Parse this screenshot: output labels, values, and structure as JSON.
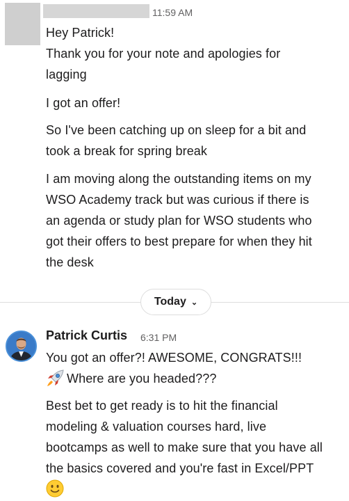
{
  "first_message": {
    "timestamp": "11:59 AM",
    "lines": [
      "Hey Patrick!",
      "Thank you for your note and apologies for",
      "lagging",
      "I got an offer!",
      "So I've been catching up on sleep for a bit and",
      "took a break for spring break",
      "I am moving along the outstanding items on my",
      "WSO Academy track but was curious if there is",
      "an agenda or study plan for WSO students who",
      "got their offers to best prepare for when they hit",
      "the desk"
    ]
  },
  "date_divider": {
    "label": "Today",
    "icon": "chevron-down-icon"
  },
  "second_message": {
    "sender": "Patrick Curtis",
    "timestamp": "6:31 PM",
    "lines": [
      "You got an offer?!  AWESOME, CONGRATS!!!",
      "Where are you headed???",
      "Best bet to get ready is to hit the financial",
      "modeling & valuation courses hard, live",
      "bootcamps as well to make sure that you have all",
      "the basics covered and you're fast in Excel/PPT"
    ],
    "emojis": [
      "rocket-icon",
      "slightly-smiling-face-icon"
    ]
  },
  "colors": {
    "text": "#1d1c1d",
    "muted": "#616061",
    "divider": "#dddddd",
    "avatar_ring": "#4a90d9"
  }
}
